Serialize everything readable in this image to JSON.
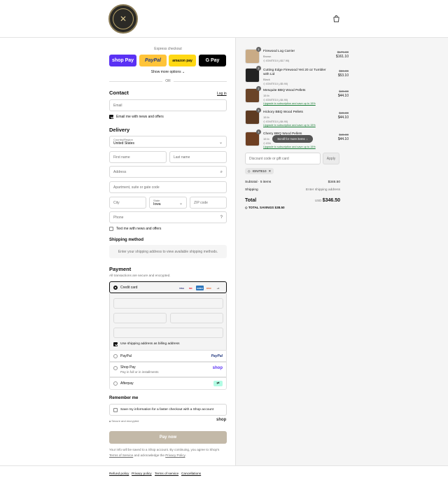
{
  "header": {
    "logo": "store-logo",
    "cart_icon": "bag-icon"
  },
  "express": {
    "label": "Express checkout",
    "buttons": [
      "shop Pay",
      "PayPal",
      "amazon pay",
      "G Pay"
    ],
    "show_more": "Show more options",
    "or": "OR"
  },
  "contact": {
    "title": "Contact",
    "login": "Log in",
    "email_placeholder": "Email",
    "news_label": "Email me with news and offers",
    "news_checked": true
  },
  "delivery": {
    "title": "Delivery",
    "country_label": "Country/Region",
    "country_value": "United States",
    "first_name": "First name",
    "last_name": "Last name",
    "address": "Address",
    "apartment": "Apartment, suite or gate code",
    "city": "City",
    "state_label": "State",
    "state_value": "Iowa",
    "zip": "ZIP code",
    "phone": "Phone",
    "text_label": "Text me with news and offers"
  },
  "shipping_method": {
    "title": "Shipping method",
    "note": "Enter your shipping address to view available shipping methods."
  },
  "payment": {
    "title": "Payment",
    "subtitle": "All transactions are secure and encrypted.",
    "credit_card": "Credit card",
    "cards": [
      "VISA",
      "MC",
      "AMEX",
      "DISC",
      "+4"
    ],
    "billing_label": "Use shipping address as billing address",
    "paypal": "PayPal",
    "paypal_logo": "PayPal",
    "shoppay": "Shop Pay",
    "shoppay_sub": "Pay in full or in installments",
    "shoppay_logo": "shop",
    "afterpay": "Afterpay"
  },
  "remember": {
    "title": "Remember me",
    "label": "Save my information for a faster checkout with a Shop account",
    "secure": "Secure and encrypted",
    "shop_logo": "shop"
  },
  "pay_now": "Pay now",
  "legal": {
    "text1": "Your info will be saved to a Shop account. By continuing, you agree to Shop's",
    "tos": "Terms of Service",
    "text2": "and acknowledge the",
    "privacy": "Privacy Policy",
    "end": "."
  },
  "cart": {
    "items": [
      {
        "qty": "1",
        "name": "Firewood Log Carrier",
        "variant": "Brown",
        "discount": "IGNITE10 (-$17.90)",
        "old": "$179.00",
        "price": "$161.10",
        "upgrade": ""
      },
      {
        "qty": "1",
        "name": "Cutting Edge Firewood Yeti 20 oz Tumbler with Lid",
        "variant": "Black",
        "discount": "IGNITE10 (-$5.90)",
        "old": "$59.00",
        "price": "$53.10",
        "upgrade": ""
      },
      {
        "qty": "1",
        "name": "Mesquite BBQ Wood Pellets",
        "variant": "15 lb",
        "discount": "IGNITE10 (-$4.90)",
        "old": "$49.00",
        "price": "$44.10",
        "upgrade": "Upgrade to subscription and save up to 15%"
      },
      {
        "qty": "1",
        "name": "Hickory BBQ Wood Pellets",
        "variant": "15 lb",
        "discount": "IGNITE10 (-$4.90)",
        "old": "$49.00",
        "price": "$44.10",
        "upgrade": "Upgrade to subscription and save up to 15%"
      },
      {
        "qty": "1",
        "name": "Cherry BBQ Wood Pellets",
        "variant": "15 lb",
        "discount": "IGN",
        "old": "$49.00",
        "price": "$44.10",
        "upgrade": "Upgrade to subscription and save up to 15%"
      }
    ],
    "scroll_tip": "Scroll for more items",
    "discount_placeholder": "Discount code or gift card",
    "apply": "Apply",
    "code_tag": "IGNITE10",
    "subtotal_label": "Subtotal · 5 items",
    "subtotal": "$346.50",
    "shipping_label": "Shipping",
    "shipping_value": "Enter shipping address",
    "total_label": "Total",
    "currency": "USD",
    "total": "$346.50",
    "savings_label": "TOTAL SAVINGS",
    "savings": "$38.50"
  },
  "footer": [
    "Refund policy",
    "Privacy policy",
    "Terms of service",
    "Cancellations"
  ]
}
